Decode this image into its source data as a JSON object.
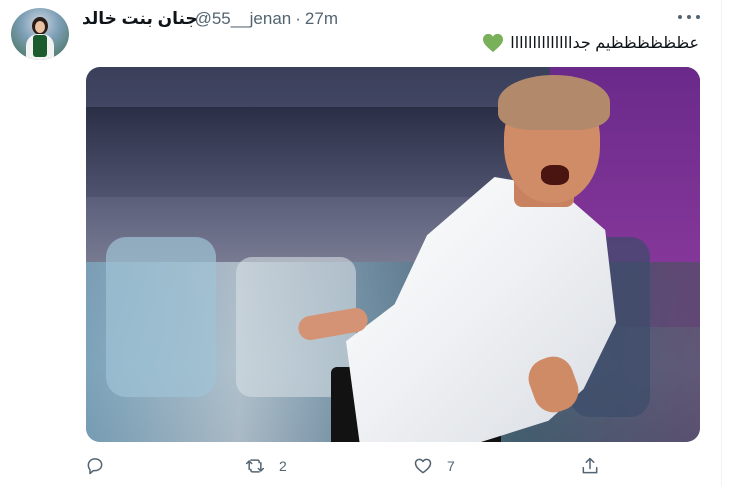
{
  "tweet": {
    "author": {
      "display_name": "جنان بنت خالد",
      "handle": "@55__jenan"
    },
    "time_separator": "·",
    "timestamp": "27m",
    "text": "عظظظظظظيم جداااااااااااااا",
    "emoji": "green-heart"
  },
  "actions": {
    "reply_count": "",
    "retweet_count": "2",
    "like_count": "7"
  },
  "colors": {
    "text_primary": "#0f1419",
    "text_secondary": "#536471",
    "heart_green": "#78b159"
  },
  "icons": [
    "more-icon",
    "reply-icon",
    "retweet-icon",
    "like-icon",
    "share-icon",
    "green-heart-emoji"
  ]
}
